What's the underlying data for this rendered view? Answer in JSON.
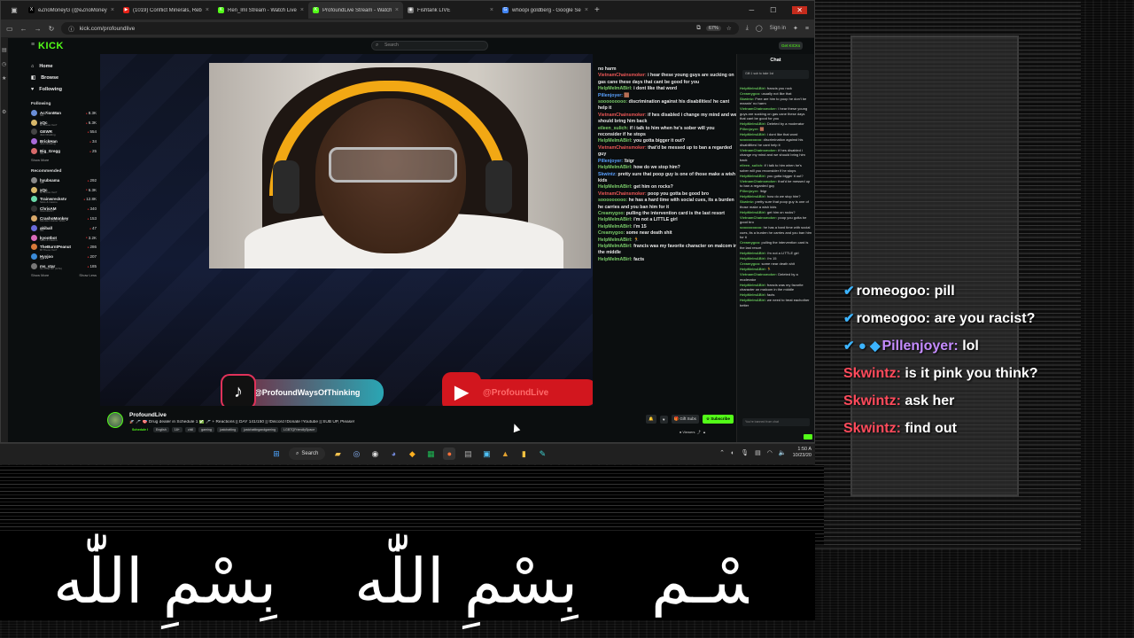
{
  "browser": {
    "tabs": [
      {
        "label": "eZnoMoneyG (@eZnoMoneyG) / X",
        "fav_color": "#000000",
        "fav_glyph": "X"
      },
      {
        "label": "(1019) Conflict Minerals, Rebels",
        "fav_color": "#e62117",
        "fav_glyph": "▶"
      },
      {
        "label": "Ren_lml Stream - Watch Live on Kick",
        "fav_color": "#53fc18",
        "fav_glyph": "K"
      },
      {
        "label": "ProfoundLive Stream - Watch Live",
        "fav_color": "#53fc18",
        "fav_glyph": "K",
        "active": true
      },
      {
        "label": "Fishtank LIVE",
        "fav_color": "#777777",
        "fav_glyph": "◉"
      },
      {
        "label": "whoopi goldberg - Google Search",
        "fav_color": "#4285f4",
        "fav_glyph": "G"
      }
    ],
    "url": "kick.com/profoundlive",
    "zoom": "67%",
    "signin_label": "Sign in"
  },
  "kick": {
    "logo": "KICK",
    "search_placeholder": "Search",
    "get_kicks": "Get KICKs",
    "nav": [
      {
        "label": "Home",
        "icon": "home-icon",
        "glyph": "⌂"
      },
      {
        "label": "Browse",
        "icon": "browse-icon",
        "glyph": "◧"
      },
      {
        "label": "Following",
        "icon": "heart-icon",
        "glyph": "♥"
      }
    ],
    "following_header": "Following",
    "following": [
      {
        "name": "Ac7ionMan",
        "sub": "IRL",
        "viewers": "8.3K",
        "color": "#6a8fd8"
      },
      {
        "name": "xQc",
        "sub": "Bf Theos Yes?",
        "viewers": "6.3K",
        "color": "#d8b86a"
      },
      {
        "name": "GEWR",
        "sub": "Just Chatting",
        "viewers": "554",
        "color": "#444444"
      },
      {
        "name": "BrickHan",
        "sub": "Just Chatting",
        "viewers": "34",
        "color": "#a86ad8"
      },
      {
        "name": "Big_Gregg",
        "sub": "IRL",
        "viewers": "25",
        "color": "#d86a6a"
      }
    ],
    "show_more": "Show More",
    "recommended_header": "Recommended",
    "recommended": [
      {
        "name": "hyubsama",
        "sub": "IRL",
        "viewers": "292",
        "color": "#888888"
      },
      {
        "name": "xQc",
        "sub": "Bf Theos Yes?",
        "viewers": "6.3K",
        "color": "#d8b86a"
      },
      {
        "name": "Trainwreckstv",
        "sub": "Slots & Casino",
        "viewers": "12.8K",
        "color": "#6ad8a8"
      },
      {
        "name": "ChrisAM",
        "sub": "VALORANT",
        "viewers": "340",
        "color": "#333333"
      },
      {
        "name": "CrashoMonkey",
        "sub": "Monster Hunter Wilds",
        "viewers": "153",
        "color": "#d8a86a"
      },
      {
        "name": "akiball",
        "sub": "IRL",
        "viewers": "47",
        "color": "#6a6ad8"
      },
      {
        "name": "kyootbot",
        "sub": "Slots & Casino",
        "viewers": "3.2K",
        "color": "#d86ab8"
      },
      {
        "name": "TheBurntPeanut",
        "sub": "Bf Theos Yes?",
        "viewers": "286",
        "color": "#d87a3a"
      },
      {
        "name": "Hyyjoo",
        "sub": "IRL",
        "viewers": "207",
        "color": "#3a8ad8"
      },
      {
        "name": "ms_star",
        "sub": "No Pixel RP (GTA)",
        "viewers": "185",
        "color": "#777777"
      }
    ],
    "show_less": "Show Less"
  },
  "stream": {
    "tiktok_handle": "@ProfoundWaysOfThinking",
    "youtube_handle": "@ProfoundLive",
    "channel_name": "ProfoundLive",
    "title": "🚀 🎤 🎯 Drug dealer in Schedule 1 ✅ 🎤 + Reactions || DAY 141/150 || !Discord !Donate !Youtube || SUB UP, Please!",
    "category": "Schedule I",
    "tags": [
      "English",
      "18+",
      "chill",
      "gaming",
      "justchatting",
      "justchattingandgaming",
      "LGBTQFriendlySpace"
    ],
    "gift_subs": "Gift Subs",
    "subscribe": "Subscribe",
    "viewers": "Viewers"
  },
  "chat_main": [
    {
      "user": "",
      "text": "no harm",
      "c": ""
    },
    {
      "user": "VietnamChainsmoker:",
      "text": "i hear these young guys are sucking on gas cane these days that cant be good for you",
      "c": "red"
    },
    {
      "user": "HelpMeImABirl:",
      "text": "i dont like that word",
      "c": ""
    },
    {
      "user": "Pillenjoyer:",
      "text": "🟫",
      "c": "blue"
    },
    {
      "user": "sooooooooo:",
      "text": "discrimination against his disabilities! he cant help it",
      "c": ""
    },
    {
      "user": "VietnamChainsmoker:",
      "text": "if hes disabled i change my mind and we should bring him back",
      "c": "red"
    },
    {
      "user": "eileen_sulich:",
      "text": "if i talk to him when he's sober will you reconsider if he stops",
      "c": ""
    },
    {
      "user": "HelpMeImABirl:",
      "text": "you gotta bigger it out?",
      "c": ""
    },
    {
      "user": "VietnamChainsmoker:",
      "text": "that'd be messed up to ban a regarded guy",
      "c": "red"
    },
    {
      "user": "Pillenjoyer:",
      "text": "!bigr",
      "c": "blue"
    },
    {
      "user": "HelpMeImABirl:",
      "text": "how do we stop him?",
      "c": ""
    },
    {
      "user": "Skwintz:",
      "text": "pretty sure that poop guy is one of those make a wish kids",
      "c": "blue"
    },
    {
      "user": "HelpMeImABirl:",
      "text": "get him on rocks?",
      "c": ""
    },
    {
      "user": "VietnamChainsmoker:",
      "text": "poop you gotta be good bro",
      "c": "red"
    },
    {
      "user": "sooooooooo:",
      "text": "he has a hard time with social cues, its a burden he carries and you ban him for it",
      "c": ""
    },
    {
      "user": "Creamygoo:",
      "text": "pulling the intervention card is the last resort",
      "c": ""
    },
    {
      "user": "HelpMeImABirl:",
      "text": "i'm not a LITTLE girl",
      "c": ""
    },
    {
      "user": "HelpMeImABirl:",
      "text": "i'm 15",
      "c": ""
    },
    {
      "user": "Creamygoo:",
      "text": "some near death shit",
      "c": ""
    },
    {
      "user": "HelpMeImABirl:",
      "text": "🏃",
      "c": ""
    },
    {
      "user": "HelpMeImABirl:",
      "text": "francis was my favorite character on malcom in the middle",
      "c": ""
    },
    {
      "user": "HelpMeImABirl:",
      "text": "facts",
      "c": ""
    }
  ],
  "chat_panel": {
    "title": "Chat",
    "gift_note": "Gift 1 sub to take 1st",
    "lines": [
      {
        "user": "HelpMeImABirl:",
        "text": "francis you rock"
      },
      {
        "user": "Creamygoo:",
        "text": "usually not like that"
      },
      {
        "user": "Skwintz:",
        "text": "Free are him to poop he don't be meanin' no harm"
      },
      {
        "user": "VietnamChainsmoker:",
        "text": "i hear these young guys are sucking on gas cane these days that cant be good for you"
      },
      {
        "user": "HelpMeImABirl:",
        "text": "Deleted by a moderator"
      },
      {
        "user": "Pillenjoyer:",
        "text": "🟫"
      },
      {
        "user": "HelpMeImABirl:",
        "text": "i dont like that word"
      },
      {
        "user": "sooooooooo:",
        "text": "discrimination against his disabilities! he cant help it"
      },
      {
        "user": "VietnamChainsmoker:",
        "text": "if hes disabled i change my mind and we should bring him back"
      },
      {
        "user": "eileen_sulich:",
        "text": "if i talk to him when he's sober will you reconsider if he stops"
      },
      {
        "user": "HelpMeImABirl:",
        "text": "you gotta bigger it out?"
      },
      {
        "user": "VietnamChainsmoker:",
        "text": "that'd be messed up to ban a regarded guy"
      },
      {
        "user": "Pillenjoyer:",
        "text": "!bigr"
      },
      {
        "user": "HelpMeImABirl:",
        "text": "how do we stop him?"
      },
      {
        "user": "Skwintz:",
        "text": "pretty sure that poop guy is one of those make a wish kids"
      },
      {
        "user": "HelpMeImABirl:",
        "text": "get him on rocks?"
      },
      {
        "user": "VietnamChainsmoker:",
        "text": "poop you gotta be good bro"
      },
      {
        "user": "sooooooooo:",
        "text": "he has a hard time with social cues, its a burden he carries and you ban him for it"
      },
      {
        "user": "Creamygoo:",
        "text": "pulling the intervention card is the last resort"
      },
      {
        "user": "HelpMeImABirl:",
        "text": "i'm not a LITTLE girl"
      },
      {
        "user": "HelpMeImABirl:",
        "text": "i'm 15"
      },
      {
        "user": "Creamygoo:",
        "text": "some near death shit"
      },
      {
        "user": "HelpMeImABirl:",
        "text": "🏃"
      },
      {
        "user": "VietnamChainsmoker:",
        "text": "Deleted by a moderator"
      },
      {
        "user": "HelpMeImABirl:",
        "text": "francis was my favorite character on malcom in the middle"
      },
      {
        "user": "HelpMeImABirl:",
        "text": "facts"
      },
      {
        "user": "HelpMeImABirl:",
        "text": "we need to treat eachother better"
      }
    ],
    "input_placeholder": "You're banned from chat"
  },
  "overlay_chat": [
    {
      "badges": "✔",
      "user": "romeogoo:",
      "text": "pill",
      "user_color": "#ffffff"
    },
    {
      "badges": "✔",
      "user": "romeogoo:",
      "text": "are you racist?",
      "user_color": "#ffffff"
    },
    {
      "badges": "✔ ● ◆",
      "user": "Pillenjoyer:",
      "text": "lol",
      "user_color": "#c58cff"
    },
    {
      "badges": "",
      "user": "Skwintz:",
      "text": "is it pink you think?",
      "user_color": "#ff4b5c"
    },
    {
      "badges": "",
      "user": "Skwintz:",
      "text": "ask her",
      "user_color": "#ff4b5c"
    },
    {
      "badges": "",
      "user": "Skwintz:",
      "text": "find out",
      "user_color": "#ff4b5c"
    }
  ],
  "banner": {
    "segments": [
      "بِسْمِ اللّٰه",
      "بِسْمِ اللّٰه",
      "بِسْـم"
    ]
  },
  "taskbar": {
    "search_label": "Search",
    "time": "1:50 A",
    "date": "10/23/20"
  }
}
